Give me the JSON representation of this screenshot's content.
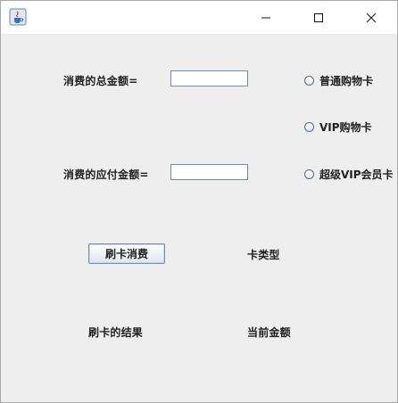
{
  "titlebar": {
    "icons": {
      "app": "java-cup-icon",
      "minimize": "minimize-icon",
      "maximize": "maximize-icon",
      "close": "close-icon"
    }
  },
  "form": {
    "total_amount_label": "消费的总金额=",
    "total_amount_value": "",
    "payable_amount_label": "消费的应付金额=",
    "payable_amount_value": ""
  },
  "card_options": [
    {
      "label": "普通购物卡",
      "selected": false
    },
    {
      "label": "VIP购物卡",
      "selected": false
    },
    {
      "label": "超级VIP会员卡",
      "selected": false
    }
  ],
  "actions": {
    "swipe_button": "刷卡消费"
  },
  "status": {
    "card_type_label": "卡类型",
    "swipe_result_label": "刷卡的结果",
    "current_amount_label": "当前金额"
  },
  "colors": {
    "content_bg": "#eeeeee",
    "titlebar_bg": "#ffffff"
  }
}
